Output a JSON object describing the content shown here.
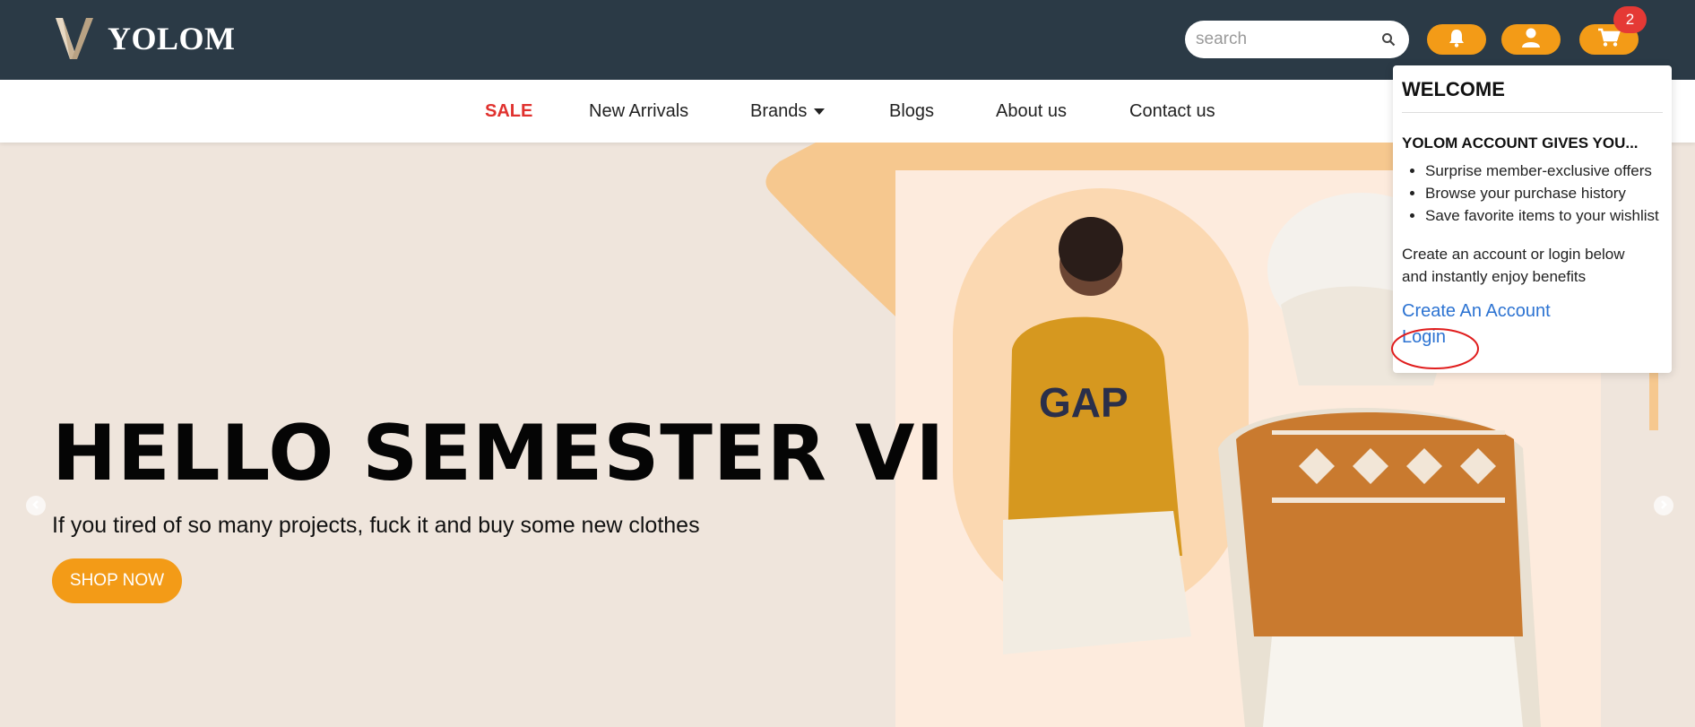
{
  "header": {
    "brand": "YOLOM",
    "search_placeholder": "search",
    "cart_count": "2",
    "colors": {
      "bar": "#2b3a46",
      "accent": "#f39b17",
      "badge": "#e53935"
    },
    "icons": [
      "logo-icon",
      "search-icon",
      "bell-icon",
      "user-icon",
      "cart-icon"
    ]
  },
  "nav": {
    "items": [
      {
        "label": "SALE"
      },
      {
        "label": "New Arrivals"
      },
      {
        "label": "Brands"
      },
      {
        "label": "Blogs"
      },
      {
        "label": "About us"
      },
      {
        "label": "Contact us"
      }
    ]
  },
  "hero": {
    "title": "HELLO SEMESTER VI",
    "subtitle": "If you tired of so many projects, fuck it and buy some new clothes",
    "cta": "SHOP NOW",
    "photo_text": "GAP"
  },
  "account_menu": {
    "title": "WELCOME",
    "subtitle": "YOLOM ACCOUNT GIVES YOU...",
    "benefits": [
      "Surprise member-exclusive offers",
      "Browse your purchase history",
      "Save favorite items to your wishlist"
    ],
    "text_line1": "Create an account or login below",
    "text_line2": "and instantly enjoy benefits",
    "create_link": "Create An Account",
    "login_link": "Login",
    "link_color": "#2c73d2"
  }
}
